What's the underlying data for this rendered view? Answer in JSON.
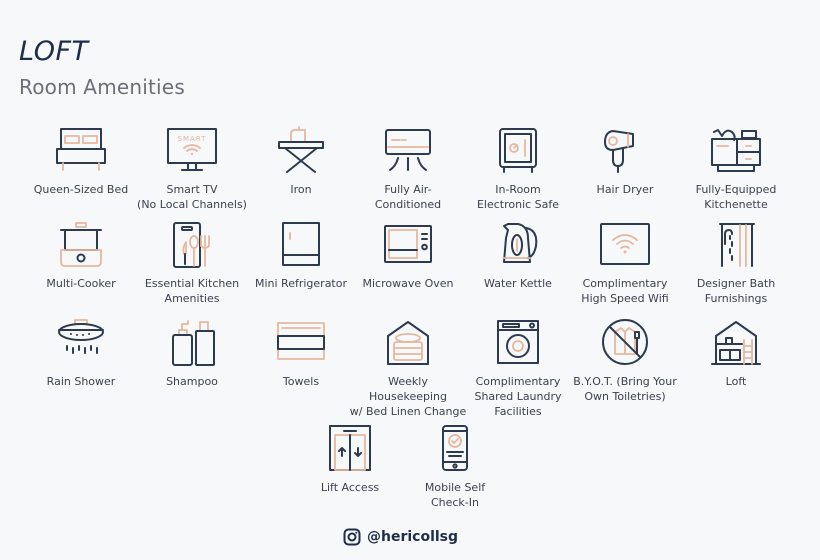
{
  "header": {
    "title": "LOFT",
    "subtitle": "Room Amenities"
  },
  "colors": {
    "stroke": "#2e3a4f",
    "accent": "#e6b79d",
    "background": "#f7f8fa"
  },
  "amenities": [
    {
      "icon": "bed-icon",
      "label": "Queen-Sized Bed"
    },
    {
      "icon": "smart-tv-icon",
      "label": "Smart TV\n(No Local Channels)",
      "icon_text": "SMART"
    },
    {
      "icon": "iron-icon",
      "label": "Iron"
    },
    {
      "icon": "air-conditioner-icon",
      "label": "Fully Air-\nConditioned"
    },
    {
      "icon": "safe-icon",
      "label": "In-Room\nElectronic Safe"
    },
    {
      "icon": "hair-dryer-icon",
      "label": "Hair Dryer"
    },
    {
      "icon": "kitchenette-icon",
      "label": "Fully-Equipped\nKitchenette"
    },
    {
      "icon": "multi-cooker-icon",
      "label": "Multi-Cooker"
    },
    {
      "icon": "kitchen-utensils-icon",
      "label": "Essential Kitchen\nAmenities"
    },
    {
      "icon": "mini-fridge-icon",
      "label": "Mini Refrigerator"
    },
    {
      "icon": "microwave-icon",
      "label": "Microwave Oven"
    },
    {
      "icon": "kettle-icon",
      "label": "Water Kettle"
    },
    {
      "icon": "wifi-icon",
      "label": "Complimentary\nHigh Speed Wifi"
    },
    {
      "icon": "bath-shower-icon",
      "label": "Designer Bath\nFurnishings"
    },
    {
      "icon": "rain-shower-icon",
      "label": "Rain Shower"
    },
    {
      "icon": "shampoo-icon",
      "label": "Shampoo"
    },
    {
      "icon": "towels-icon",
      "label": "Towels"
    },
    {
      "icon": "housekeeping-icon",
      "label": "Weekly Housekeeping\nw/ Bed Linen Change"
    },
    {
      "icon": "washing-machine-icon",
      "label": "Complimentary\nShared Laundry\nFacilities"
    },
    {
      "icon": "no-toiletries-icon",
      "label": "B.Y.O.T. (Bring Your\nOwn Toiletries)"
    },
    {
      "icon": "loft-house-icon",
      "label": "Loft"
    },
    {
      "icon": "lift-icon",
      "label": "Lift Access"
    },
    {
      "icon": "mobile-checkin-icon",
      "label": "Mobile Self\nCheck-In"
    }
  ],
  "footer": {
    "icon": "instagram-icon",
    "handle": "@hericollsg"
  }
}
